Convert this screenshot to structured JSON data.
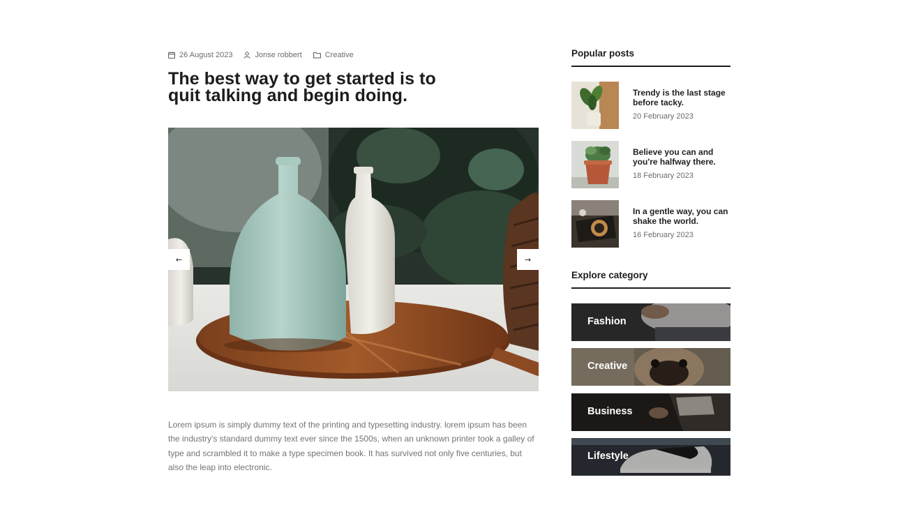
{
  "post": {
    "meta": {
      "date": "26 August 2023",
      "author": "Jonse robbert",
      "category": "Creative",
      "date_icon": "calendar-icon",
      "author_icon": "user-icon",
      "category_icon": "folder-icon"
    },
    "title": "The best way to get started is to quit talking and begin doing.",
    "slider": {
      "prev_label": "←",
      "next_label": "→"
    },
    "body": "Lorem ipsum is simply dummy text of the printing and typesetting industry. lorem ipsum has been the industry's standard dummy text ever since the 1500s, when an unknown printer took a galley of type and scrambled it to make a type specimen book. It has survived not only five centuries, but also the leap into electronic."
  },
  "sidebar": {
    "popular_heading": "Popular posts",
    "popular_posts": [
      {
        "title": "Trendy is the last stage before tacky.",
        "date": "20 February 2023"
      },
      {
        "title": "Believe you can and you're halfway there.",
        "date": "18 February 2023"
      },
      {
        "title": "In a gentle way, you can shake the world.",
        "date": "16 February 2023"
      }
    ],
    "explore_heading": "Explore category",
    "categories": [
      {
        "label": "Fashion"
      },
      {
        "label": "Creative"
      },
      {
        "label": "Business"
      },
      {
        "label": "Lifestyle"
      }
    ]
  },
  "colors": {
    "text_dark": "#1c1c1c",
    "text_muted": "#737373",
    "divider": "#1c1c1c",
    "background": "#ffffff"
  }
}
